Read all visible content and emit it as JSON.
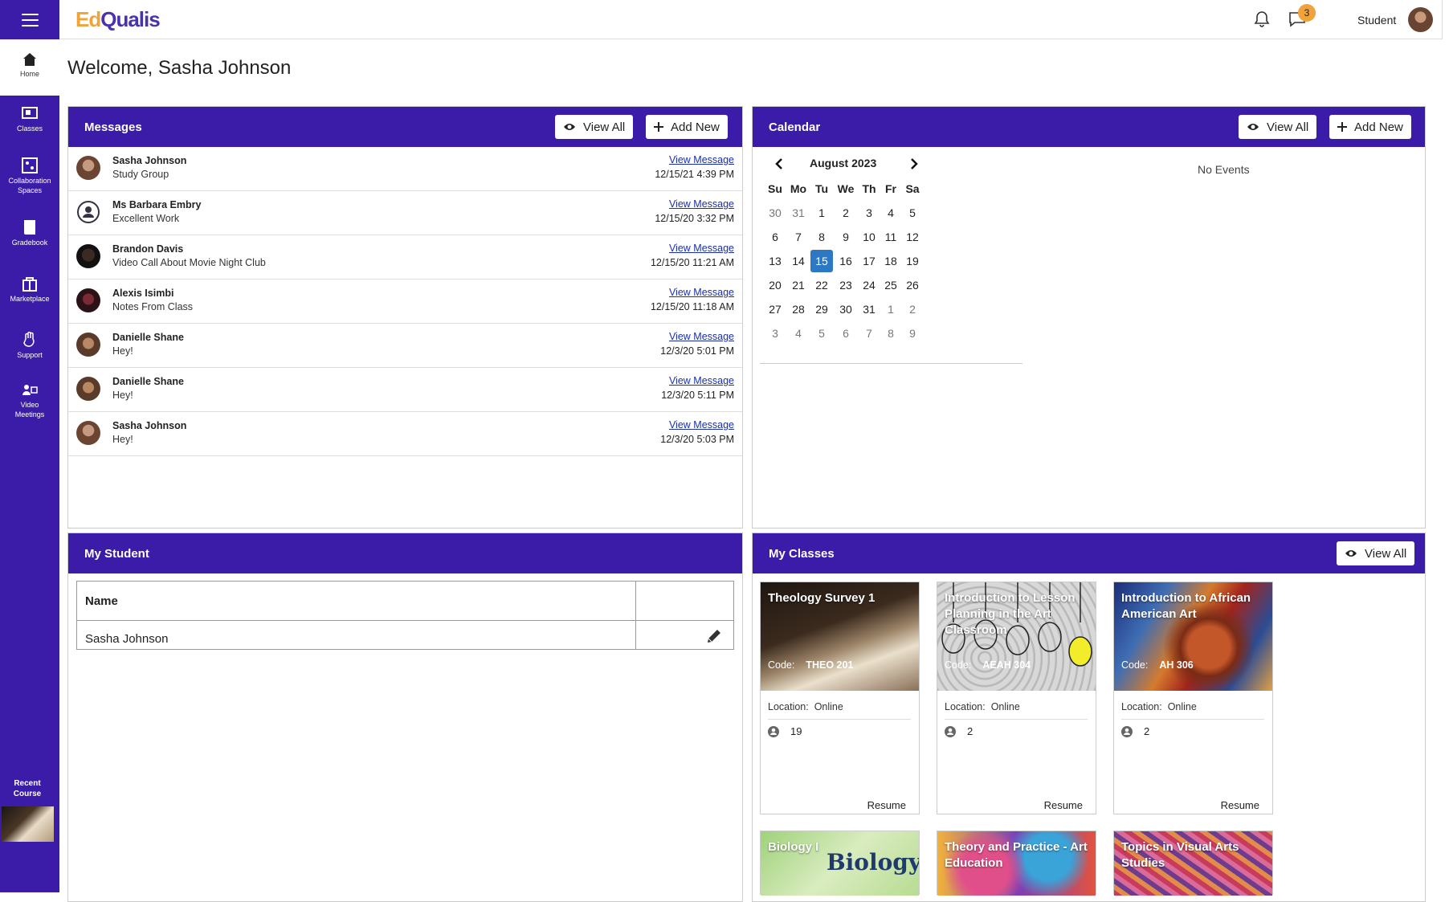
{
  "app": {
    "logo": {
      "part1": "Ed",
      "part2": "Qualis"
    },
    "role": "Student",
    "notification_count": "3"
  },
  "sidebar": {
    "items": [
      {
        "label": "Home",
        "icon": "home-icon"
      },
      {
        "label": "Classes",
        "icon": "classes-icon"
      },
      {
        "label": "Collaboration Spaces",
        "icon": "collaboration-icon"
      },
      {
        "label": "Gradebook",
        "icon": "gradebook-icon"
      },
      {
        "label": "Marketplace",
        "icon": "marketplace-icon"
      },
      {
        "label": "Support",
        "icon": "support-icon"
      },
      {
        "label": "Video Meetings",
        "icon": "video-meetings-icon"
      }
    ],
    "recent_course": "Recent Course"
  },
  "welcome": "Welcome, Sasha Johnson",
  "messages": {
    "title": "Messages",
    "view_all": "View All",
    "add_new": "Add New",
    "link_label": "View Message",
    "items": [
      {
        "name": "Sasha Johnson",
        "subject": "Study Group",
        "date": "12/15/21 4:39 PM"
      },
      {
        "name": "Ms Barbara Embry",
        "subject": "Excellent Work",
        "date": "12/15/20 3:32 PM"
      },
      {
        "name": "Brandon Davis",
        "subject": "Video Call About Movie Night Club",
        "date": "12/15/20 11:21 AM"
      },
      {
        "name": "Alexis Isimbi",
        "subject": "Notes From Class",
        "date": "12/15/20 11:18 AM"
      },
      {
        "name": "Danielle Shane",
        "subject": "Hey!",
        "date": "12/3/20 5:01 PM"
      },
      {
        "name": "Danielle Shane",
        "subject": "Hey!",
        "date": "12/3/20 5:11 PM"
      },
      {
        "name": "Sasha Johnson",
        "subject": "Hey!",
        "date": "12/3/20 5:03 PM"
      }
    ]
  },
  "calendar": {
    "title": "Calendar",
    "view_all": "View All",
    "add_new": "Add New",
    "month": "August 2023",
    "weekdays": [
      "Su",
      "Mo",
      "Tu",
      "We",
      "Th",
      "Fr",
      "Sa"
    ],
    "weeks": [
      [
        "30",
        "31",
        "1",
        "2",
        "3",
        "4",
        "5"
      ],
      [
        "6",
        "7",
        "8",
        "9",
        "10",
        "11",
        "12"
      ],
      [
        "13",
        "14",
        "15",
        "16",
        "17",
        "18",
        "19"
      ],
      [
        "20",
        "21",
        "22",
        "23",
        "24",
        "25",
        "26"
      ],
      [
        "27",
        "28",
        "29",
        "30",
        "31",
        "1",
        "2"
      ],
      [
        "3",
        "4",
        "5",
        "6",
        "7",
        "8",
        "9"
      ]
    ],
    "selected_day": "15",
    "no_events": "No Events"
  },
  "my_student": {
    "title": "My Student",
    "header_name": "Name",
    "student_name": "Sasha Johnson"
  },
  "my_classes": {
    "title": "My Classes",
    "view_all": "View All",
    "code_label": "Code:",
    "location_label": "Location:",
    "resume_label": "Resume",
    "cards": [
      {
        "title": "Theology Survey 1",
        "code": "THEO 201",
        "location": "Online",
        "students": "19"
      },
      {
        "title": "Introduction to Lesson Planning in the Art Classroom",
        "code": "AEAH 304",
        "location": "Online",
        "students": "2"
      },
      {
        "title": "Introduction to African American Art",
        "code": "AH 306",
        "location": "Online",
        "students": "2"
      },
      {
        "title": "Biology I"
      },
      {
        "title": "Theory and Practice - Art Education"
      },
      {
        "title": "Topics in Visual Arts Studies"
      }
    ],
    "biology_watermark": "Biology"
  },
  "colors": {
    "brand_purple": "#3a1ca8",
    "accent_orange": "#f0a33a",
    "selected_day_blue": "#2d78c4",
    "link_blue": "#1a2fa8"
  }
}
